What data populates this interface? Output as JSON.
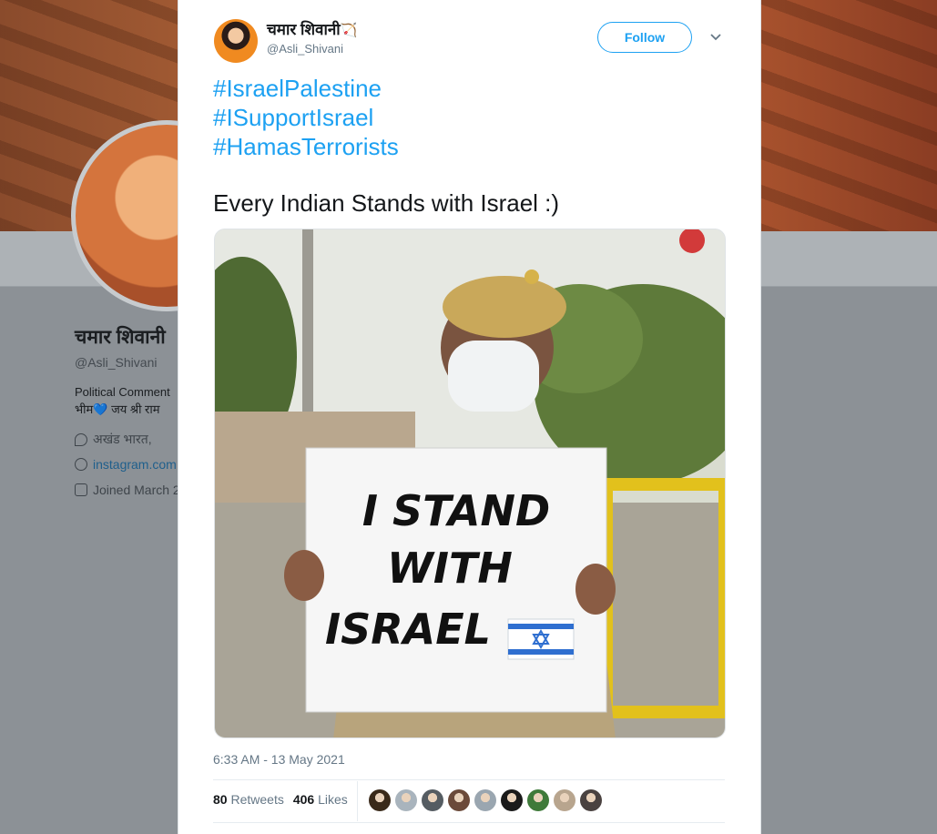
{
  "background_profile": {
    "name": "चमार शिवानी",
    "handle": "@Asli_Shivani",
    "bio_line1": "Political Comment",
    "bio_line2": "भीम💙 जय श्री राम",
    "location": "अखंड भारत,",
    "link": "instagram.com",
    "joined": "Joined March 2"
  },
  "tweet": {
    "author_name": "चमार शिवानी",
    "author_emoji": "🏹",
    "author_handle": "@Asli_Shivani",
    "follow_label": "Follow",
    "hashtags": [
      "#IsraelPalestine",
      "#ISupportIsrael",
      "#HamasTerrorists"
    ],
    "text": "Every Indian Stands with Israel :)",
    "media_sign_lines": [
      "I STAND",
      "WITH",
      "ISRAEL"
    ],
    "timestamp": "6:33 AM - 13 May 2021",
    "retweets_count": "80",
    "retweets_label": "Retweets",
    "likes_count": "406",
    "likes_label": "Likes"
  },
  "liker_avatar_colors": [
    "#3a2a1a",
    "#a9b4bd",
    "#555c62",
    "#6b4a3a",
    "#9aa6b0",
    "#1a1a1a",
    "#3f7a3a",
    "#b8a58e",
    "#4a4240"
  ],
  "colors": {
    "accent": "#1da1f2",
    "text": "#14171a",
    "muted": "#657786"
  }
}
